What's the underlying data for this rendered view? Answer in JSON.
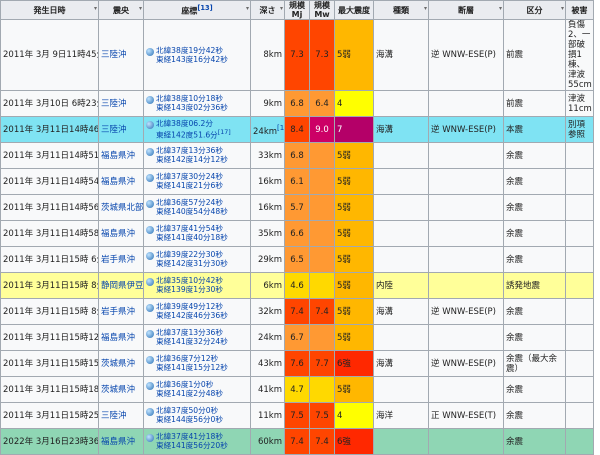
{
  "headers": {
    "datetime": "発生日時",
    "epicenter": "震央",
    "coords": "座標",
    "coords_ref": "[13]",
    "depth": "深さ",
    "scale_mj": "規模",
    "scale_mj_sub": "Mj",
    "scale_mw": "規模",
    "scale_mw_sub": "Mw",
    "intensity": "最大震度",
    "type": "種類",
    "fault": "断層",
    "category": "区分",
    "damage": "被害"
  },
  "colors": {
    "row_default": "#f8f9fa",
    "row_cyan": "#7fe3f3",
    "row_yellow": "#ffff99",
    "row_green": "#8fd6b4",
    "mag_orange": "#ff9933",
    "mag_red": "#ff4500",
    "mag_darkred": "#cc0066",
    "mag_purple": "#a52a2a",
    "mag_yellow": "#ffd900",
    "int_orange": "#ffb700",
    "int_yellow": "#ffff00",
    "int_red": "#ff2800",
    "int_purple": "#b40068"
  },
  "rows": [
    {
      "datetime": "2011年 3月 9日11時45分",
      "epicenter": "三陸沖",
      "lat": "北緯38度19分42秒",
      "lon": "東経143度16分42秒",
      "depth": "8km",
      "mj": "7.3",
      "mw": "7.3",
      "intensity": "5弱",
      "type": "海溝",
      "fault": "逆 WNW-ESE(P)",
      "category": "前震",
      "damage": "負傷2、一部破損1棟、津波55cm",
      "bg": "row_default",
      "mj_c": "mag_red",
      "mw_c": "mag_red",
      "int_c": "int_orange"
    },
    {
      "datetime": "2011年 3月10日 6時23分",
      "epicenter": "三陸沖",
      "lat": "北緯38度10分18秒",
      "lon": "東経143度02分36秒",
      "depth": "9km",
      "mj": "6.8",
      "mw": "6.4",
      "intensity": "4",
      "type": "",
      "fault": "",
      "category": "前震",
      "damage": "津波11cm",
      "bg": "row_default",
      "mj_c": "mag_orange",
      "mw_c": "mag_orange",
      "int_c": "int_yellow"
    },
    {
      "datetime": "2011年 3月11日14時46分",
      "epicenter": "三陸沖",
      "lat": "北緯38度06.2分",
      "lon": "東経142度51.6分",
      "ref": "[17]",
      "depth": "24km",
      "depth_ref": "[18]",
      "mj": "8.4",
      "mw": "9.0",
      "intensity": "7",
      "type": "海溝",
      "fault": "逆 WNW-ESE(P)",
      "category": "本震",
      "damage": "別項参照",
      "bg": "row_cyan",
      "mj_c": "mag_red",
      "mw_c": "mag_darkred",
      "int_c": "int_purple"
    },
    {
      "datetime": "2011年 3月11日14時51分",
      "epicenter": "福島県沖",
      "lat": "北緯37度13分36秒",
      "lon": "東経142度14分12秒",
      "depth": "33km",
      "mj": "6.8",
      "mw": "",
      "intensity": "5弱",
      "type": "",
      "fault": "",
      "category": "余震",
      "damage": "",
      "bg": "row_default",
      "mj_c": "mag_orange",
      "mw_c": "mag_orange",
      "int_c": "int_orange"
    },
    {
      "datetime": "2011年 3月11日14時54分",
      "epicenter": "福島県沖",
      "lat": "北緯37度30分24秒",
      "lon": "東経141度21分6秒",
      "depth": "16km",
      "mj": "6.1",
      "mw": "",
      "intensity": "5弱",
      "type": "",
      "fault": "",
      "category": "余震",
      "damage": "",
      "bg": "row_default",
      "mj_c": "mag_orange",
      "mw_c": "mag_orange",
      "int_c": "int_orange"
    },
    {
      "datetime": "2011年 3月11日14時56分",
      "epicenter": "茨城県北部",
      "lat": "北緯36度57分24秒",
      "lon": "東経140度54分48秒",
      "depth": "16km",
      "mj": "5.7",
      "mw": "",
      "intensity": "5弱",
      "type": "",
      "fault": "",
      "category": "余震",
      "damage": "",
      "bg": "row_default",
      "mj_c": "mag_orange",
      "mw_c": "mag_orange",
      "int_c": "int_orange"
    },
    {
      "datetime": "2011年 3月11日14時58分",
      "epicenter": "福島県沖",
      "lat": "北緯37度41分54秒",
      "lon": "東経141度40分18秒",
      "depth": "35km",
      "mj": "6.6",
      "mw": "",
      "intensity": "5弱",
      "type": "",
      "fault": "",
      "category": "余震",
      "damage": "",
      "bg": "row_default",
      "mj_c": "mag_orange",
      "mw_c": "mag_orange",
      "int_c": "int_orange"
    },
    {
      "datetime": "2011年 3月11日15時 6分",
      "epicenter": "岩手県沖",
      "lat": "北緯39度22分30秒",
      "lon": "東経142度31分30秒",
      "depth": "29km",
      "mj": "6.5",
      "mw": "",
      "intensity": "5弱",
      "type": "",
      "fault": "",
      "category": "余震",
      "damage": "",
      "bg": "row_default",
      "mj_c": "mag_orange",
      "mw_c": "mag_orange",
      "int_c": "int_orange"
    },
    {
      "datetime": "2011年 3月11日15時 8分",
      "epicenter": "静岡県伊豆地方",
      "lat": "北緯35度10分42秒",
      "lon": "東経139度1分30秒",
      "depth": "6km",
      "mj": "4.6",
      "mw": "",
      "intensity": "5弱",
      "type": "内陸",
      "fault": "",
      "category": "誘発地震",
      "damage": "",
      "bg": "row_yellow",
      "mj_c": "mag_yellow",
      "mw_c": "mag_yellow",
      "int_c": "int_orange"
    },
    {
      "datetime": "2011年 3月11日15時 8分",
      "epicenter": "岩手県沖",
      "lat": "北緯39度49分12秒",
      "lon": "東経142度46分36秒",
      "depth": "32km",
      "mj": "7.4",
      "mw": "7.4",
      "intensity": "5弱",
      "type": "海溝",
      "fault": "逆 WNW-ESE(P)",
      "category": "余震",
      "damage": "",
      "bg": "row_default",
      "mj_c": "mag_red",
      "mw_c": "mag_red",
      "int_c": "int_orange"
    },
    {
      "datetime": "2011年 3月11日15時12分",
      "epicenter": "福島県沖",
      "lat": "北緯37度13分36秒",
      "lon": "東経141度32分24秒",
      "depth": "24km",
      "mj": "6.7",
      "mw": "",
      "intensity": "5弱",
      "type": "",
      "fault": "",
      "category": "余震",
      "damage": "",
      "bg": "row_default",
      "mj_c": "mag_orange",
      "mw_c": "mag_orange",
      "int_c": "int_orange"
    },
    {
      "datetime": "2011年 3月11日15時15分",
      "epicenter": "茨城県沖",
      "lat": "北緯36度7分12秒",
      "lon": "東経141度15分12秒",
      "depth": "43km",
      "mj": "7.6",
      "mw": "7.7",
      "intensity": "6強",
      "type": "海溝",
      "fault": "逆 WNW-ESE(P)",
      "category": "余震（最大余震）",
      "damage": "",
      "bg": "row_default",
      "mj_c": "mag_red",
      "mw_c": "mag_red",
      "int_c": "int_red"
    },
    {
      "datetime": "2011年 3月11日15時18分",
      "epicenter": "茨城県沖",
      "lat": "北緯36度1分0秒",
      "lon": "東経141度2分48秒",
      "depth": "41km",
      "mj": "4.7",
      "mw": "",
      "intensity": "5弱",
      "type": "",
      "fault": "",
      "category": "余震",
      "damage": "",
      "bg": "row_default",
      "mj_c": "mag_yellow",
      "mw_c": "mag_yellow",
      "int_c": "int_orange"
    },
    {
      "datetime": "2011年 3月11日15時25分",
      "epicenter": "三陸沖",
      "lat": "北緯37度50分0秒",
      "lon": "東経144度56分0秒",
      "depth": "11km",
      "mj": "7.5",
      "mw": "7.5",
      "intensity": "4",
      "type": "海洋",
      "fault": "正 WNW-ESE(T)",
      "category": "余震",
      "damage": "",
      "bg": "row_default",
      "mj_c": "mag_red",
      "mw_c": "mag_red",
      "int_c": "int_yellow"
    },
    {
      "datetime": "2022年 3月16日23時36分",
      "epicenter": "福島県沖",
      "lat": "北緯37度41分18秒",
      "lon": "東経141度56分20秒",
      "depth": "60km",
      "mj": "7.4",
      "mw": "7.4",
      "intensity": "6強",
      "type": "",
      "fault": "",
      "category": "余震",
      "damage": "",
      "bg": "row_green",
      "mj_c": "mag_red",
      "mw_c": "mag_red",
      "int_c": "int_red"
    }
  ]
}
